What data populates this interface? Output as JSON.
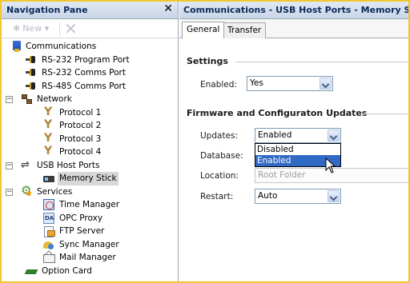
{
  "nav_pane": {
    "title": "Navigation Pane",
    "close_icon": "close-icon",
    "toolbar": {
      "new_label": "New ▾",
      "new_icon": "sparkle-icon",
      "delete_icon": "delete-x-icon"
    },
    "tree": [
      {
        "label": "Communications",
        "icon": "communications-icon",
        "level": 0,
        "expander": ""
      },
      {
        "label": "RS-232 Program Port",
        "icon": "serial-port-icon",
        "level": 1
      },
      {
        "label": "RS-232 Comms Port",
        "icon": "serial-port-icon",
        "level": 1
      },
      {
        "label": "RS-485 Comms Port",
        "icon": "serial-port-icon",
        "level": 1
      },
      {
        "label": "Network",
        "icon": "network-icon",
        "level": 1,
        "expander": "−"
      },
      {
        "label": "Protocol 1",
        "icon": "protocol-icon",
        "level": 2
      },
      {
        "label": "Protocol 2",
        "icon": "protocol-icon",
        "level": 2
      },
      {
        "label": "Protocol 3",
        "icon": "protocol-icon",
        "level": 2
      },
      {
        "label": "Protocol 4",
        "icon": "protocol-icon",
        "level": 2
      },
      {
        "label": "USB Host Ports",
        "icon": "usb-icon",
        "level": 1,
        "expander": "−"
      },
      {
        "label": "Memory Stick",
        "icon": "memory-stick-icon",
        "level": 2,
        "selected": true
      },
      {
        "label": "Services",
        "icon": "services-icon",
        "level": 1,
        "expander": "−"
      },
      {
        "label": "Time Manager",
        "icon": "time-manager-icon",
        "level": 2
      },
      {
        "label": "OPC Proxy",
        "icon": "opc-proxy-icon",
        "level": 2
      },
      {
        "label": "FTP Server",
        "icon": "ftp-server-icon",
        "level": 2
      },
      {
        "label": "Sync Manager",
        "icon": "sync-manager-icon",
        "level": 2
      },
      {
        "label": "Mail Manager",
        "icon": "mail-manager-icon",
        "level": 2
      },
      {
        "label": "Option Card",
        "icon": "option-card-icon",
        "level": 1
      }
    ]
  },
  "content": {
    "title": "Communications - USB Host Ports - Memory Stick",
    "tabs": [
      {
        "label": "General",
        "active": true
      },
      {
        "label": "Transfer",
        "active": false
      }
    ],
    "settings": {
      "group_title": "Settings",
      "enabled_label": "Enabled:",
      "enabled_value": "Yes"
    },
    "firmware": {
      "group_title": "Firmware and Configuraton Updates",
      "updates_label": "Updates:",
      "updates_value": "Enabled",
      "updates_options": [
        "Disabled",
        "Enabled"
      ],
      "updates_highlighted": "Enabled",
      "database_label": "Database:",
      "location_label": "Location:",
      "location_placeholder": "Root Folder",
      "restart_label": "Restart:",
      "restart_value": "Auto"
    }
  },
  "colors": {
    "frame_border": "#f2c72e",
    "header_bg": "#c9d6e8",
    "selection_highlight": "#316ac5",
    "tree_selection": "#d7d7d7"
  }
}
